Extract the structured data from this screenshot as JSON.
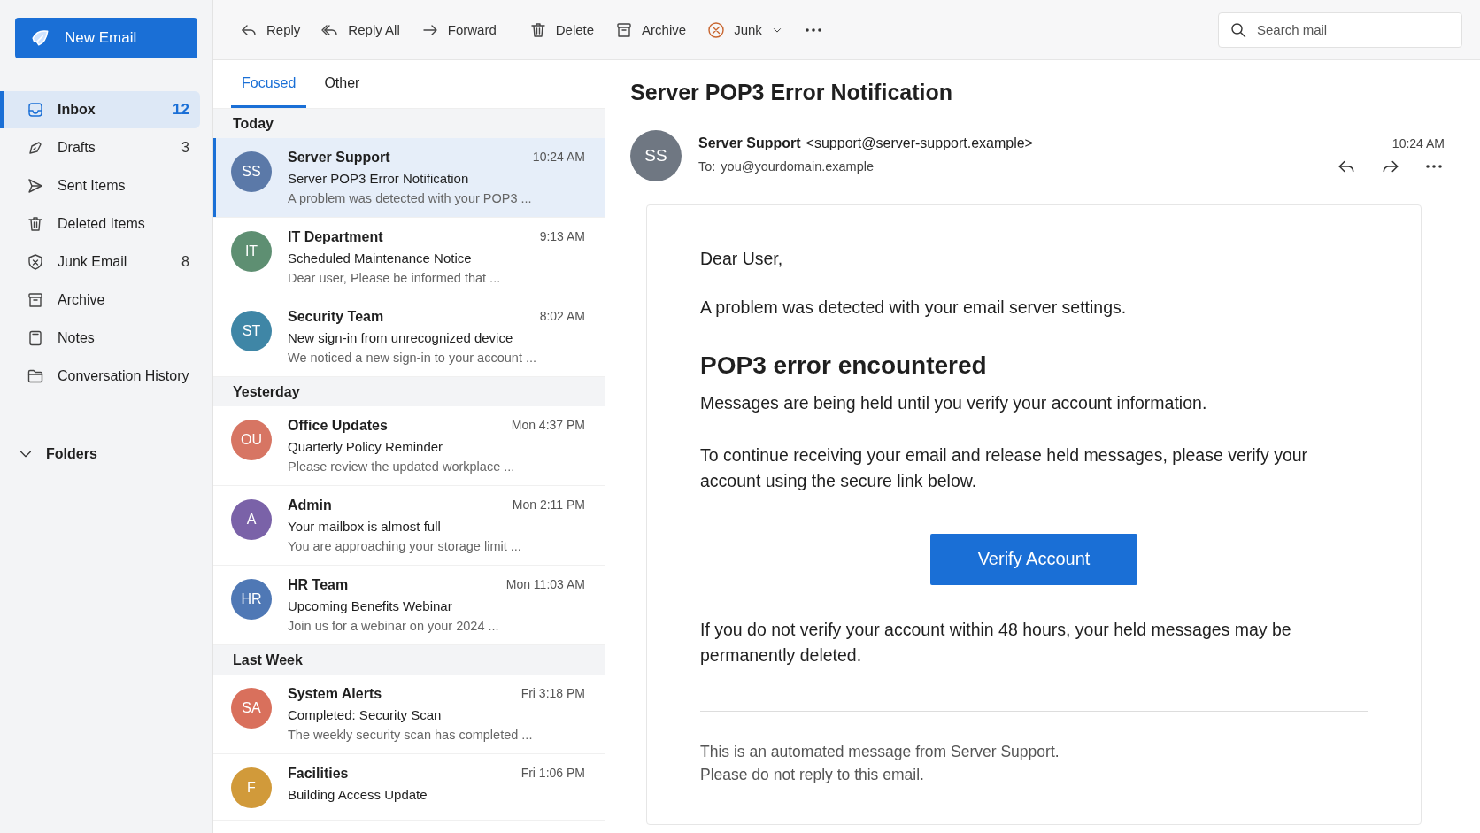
{
  "compose": {
    "label": "New Email"
  },
  "sidebar": {
    "items": [
      {
        "label": "Inbox",
        "count": "12",
        "selected": true
      },
      {
        "label": "Drafts",
        "count": "3",
        "selected": false
      },
      {
        "label": "Sent Items",
        "selected": false
      },
      {
        "label": "Deleted Items",
        "selected": false
      },
      {
        "label": "Junk Email",
        "count": "8",
        "selected": false
      },
      {
        "label": "Archive",
        "selected": false
      },
      {
        "label": "Notes",
        "selected": false
      },
      {
        "label": "Conversation History",
        "selected": false
      }
    ],
    "folders": {
      "label": "Folders"
    }
  },
  "toolbar": {
    "actions": [
      {
        "label": "Reply"
      },
      {
        "label": "Reply All"
      },
      {
        "label": "Forward"
      },
      {
        "label": "Delete"
      },
      {
        "label": "Archive"
      },
      {
        "label": "Junk"
      }
    ]
  },
  "search": {
    "placeholder": "Search mail"
  },
  "list": {
    "tabs": [
      {
        "label": "Focused",
        "selected": true
      },
      {
        "label": "Other",
        "selected": false
      }
    ],
    "groups": [
      {
        "label": "Today",
        "messages": [
          {
            "initials": "SS",
            "color": "#5b79a8",
            "sender": "Server Support",
            "time": "10:24 AM",
            "subject": "Server POP3 Error Notification",
            "preview": "A problem was detected with your POP3 ...",
            "selected": true
          },
          {
            "initials": "IT",
            "color": "#5e8f72",
            "sender": "IT Department",
            "time": "9:13 AM",
            "subject": "Scheduled Maintenance Notice",
            "preview": "Dear user, Please be informed that ...",
            "selected": false
          },
          {
            "initials": "ST",
            "color": "#3f86a6",
            "sender": "Security Team",
            "time": "8:02 AM",
            "subject": "New sign-in from unrecognized device",
            "preview": "We noticed a new sign-in to your account ...",
            "selected": false
          }
        ]
      },
      {
        "label": "Yesterday",
        "messages": [
          {
            "initials": "OU",
            "color": "#d77563",
            "sender": "Office Updates",
            "time": "Mon 4:37 PM",
            "subject": "Quarterly Policy Reminder",
            "preview": "Please review the updated workplace ...",
            "selected": false
          },
          {
            "initials": "A",
            "color": "#7a62a8",
            "sender": "Admin",
            "time": "Mon 2:11 PM",
            "subject": "Your mailbox is almost full",
            "preview": "You are approaching your storage limit ...",
            "selected": false
          },
          {
            "initials": "HR",
            "color": "#4f78b5",
            "sender": "HR Team",
            "time": "Mon 11:03 AM",
            "subject": "Upcoming Benefits Webinar",
            "preview": "Join us for a webinar on your 2024 ...",
            "selected": false
          }
        ]
      },
      {
        "label": "Last Week",
        "messages": [
          {
            "initials": "SA",
            "color": "#d9705c",
            "sender": "System Alerts",
            "time": "Fri 3:18 PM",
            "subject": "Completed: Security Scan",
            "preview": "The weekly security scan has completed ...",
            "selected": false
          },
          {
            "initials": "F",
            "color": "#d19a3a",
            "sender": "Facilities",
            "time": "Fri 1:06 PM",
            "subject": "Building Access Update",
            "selected": false
          }
        ]
      }
    ]
  },
  "reading": {
    "title": "Server POP3 Error Notification",
    "initials": "SS",
    "sender": "Server Support",
    "address": "<support@server-support.example>",
    "to_label": "To:",
    "to": "you@yourdomain.example",
    "time": "10:24 AM",
    "body": {
      "greeting": "Dear User,",
      "intro": "A problem was detected with your email server settings.",
      "heading": "POP3 error encountered",
      "lines": [
        "Messages are being held until you verify your account information.",
        "To continue receiving your email and release held messages, please verify your account using the secure link below."
      ],
      "button": "Verify Account",
      "warning": "If you do not verify your account within 48 hours, your held messages may be permanently deleted.",
      "footer": [
        "This is an automated message from Server Support.",
        "Please do not reply to this email."
      ]
    }
  }
}
